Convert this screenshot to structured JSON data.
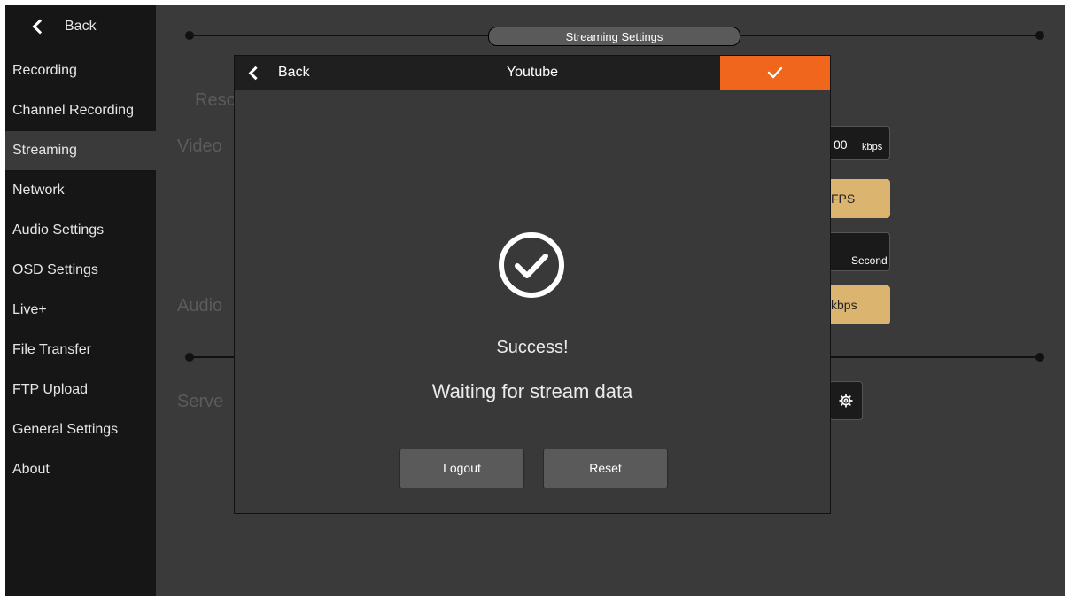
{
  "sidebar": {
    "back_label": "Back",
    "items": [
      {
        "label": "Recording"
      },
      {
        "label": "Channel Recording"
      },
      {
        "label": "Streaming"
      },
      {
        "label": "Network"
      },
      {
        "label": "Audio Settings"
      },
      {
        "label": "OSD Settings"
      },
      {
        "label": "Live+"
      },
      {
        "label": "File Transfer"
      },
      {
        "label": "FTP Upload"
      },
      {
        "label": "General Settings"
      },
      {
        "label": "About"
      }
    ],
    "active": "Streaming"
  },
  "page": {
    "title": "Streaming Settings",
    "ghost_labels": {
      "resolution": "Reso",
      "video": "Video",
      "audio": "Audio",
      "server": "Serve"
    },
    "fields": {
      "video_bitrate_value": "00",
      "video_bitrate_unit": "kbps",
      "framerate_unit": "FPS",
      "gop_unit": "Second",
      "audio_bitrate_unit": "kbps"
    }
  },
  "modal": {
    "back_label": "Back",
    "title": "Youtube",
    "status": "Success!",
    "message": "Waiting for stream data",
    "logout_label": "Logout",
    "reset_label": "Reset"
  },
  "colors": {
    "accent": "#f0661d",
    "field_gold": "#dbb470",
    "sidebar_bg": "#161616",
    "page_bg": "#3a3a3a"
  },
  "icons": {
    "back": "chevron-left-icon",
    "confirm": "check-icon",
    "success": "check-circle-icon",
    "server_settings": "gear-icon"
  }
}
